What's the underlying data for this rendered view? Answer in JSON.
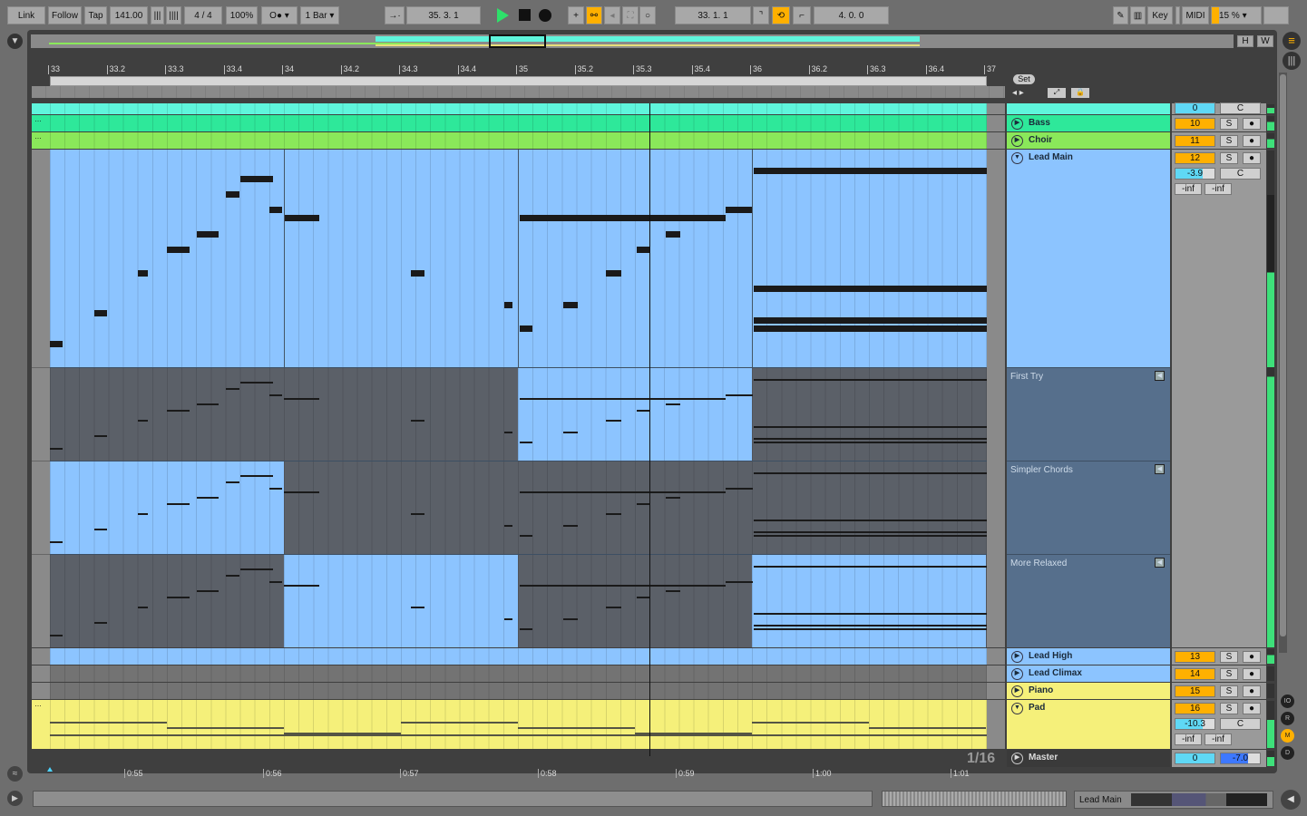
{
  "toolbar": {
    "link": "Link",
    "follow": "Follow",
    "tap": "Tap",
    "tempo": "141.00",
    "signature": "4 / 4",
    "zoom": "100%",
    "rec_mode": "O●",
    "quantize": "1 Bar",
    "position": "35.  3.  1",
    "loop_start": "33.  1.  1",
    "loop_length": "4.  0.  0",
    "key": "Key",
    "midi": "MIDI",
    "cpu": "15 %",
    "cpu_level": 15
  },
  "overview": {
    "h": "H",
    "w": "W"
  },
  "ruler": {
    "bars": [
      "33",
      "33.2",
      "33.3",
      "33.4",
      "34",
      "34.2",
      "34.3",
      "34.4",
      "35",
      "35.2",
      "35.3",
      "35.4",
      "36",
      "36.2",
      "36.3",
      "36.4",
      "37"
    ]
  },
  "set_button": "Set",
  "time_ruler": [
    "0:55",
    "0:56",
    "0:57",
    "0:58",
    "0:59",
    "1:00",
    "1:01"
  ],
  "grid": "1/16",
  "colors": {
    "cyan": "#5ff5dc",
    "bass": "#2ee89a",
    "choir": "#8ae85a",
    "blue": "#8cc4ff",
    "yellow": "#f5f07a",
    "take": "#566f8c",
    "accent": "#ffb000"
  },
  "tracks": [
    {
      "name": "",
      "num": "0",
      "vol": "C",
      "color": "#5ff5dc"
    },
    {
      "name": "Bass",
      "num": "10",
      "s": "S",
      "color": "#2ee89a"
    },
    {
      "name": "Choir",
      "num": "11",
      "s": "S",
      "color": "#8ae85a"
    },
    {
      "name": "Lead Main",
      "num": "12",
      "s": "S",
      "vol": "-3.9",
      "pan": "C",
      "peak1": "-inf",
      "peak2": "-inf",
      "color": "#8cc4ff"
    },
    {
      "name": "Lead High",
      "num": "13",
      "s": "S",
      "color": "#8cc4ff"
    },
    {
      "name": "Lead Climax",
      "num": "14",
      "s": "S",
      "color": "#8cc4ff"
    },
    {
      "name": "Piano",
      "num": "15",
      "s": "S",
      "color": "#f5f07a"
    },
    {
      "name": "Pad",
      "num": "16",
      "s": "S",
      "vol": "-10.3",
      "pan": "C",
      "peak1": "-inf",
      "peak2": "-inf",
      "color": "#f5f07a"
    },
    {
      "name": "Master",
      "num": "0",
      "vol": "-7.0"
    }
  ],
  "takes": [
    {
      "name": "First Try"
    },
    {
      "name": "Simpler Chords"
    },
    {
      "name": "More Relaxed"
    }
  ],
  "notes": [
    [
      0,
      0.22,
      0
    ],
    [
      0.76,
      0.22,
      4
    ],
    [
      1.5,
      0.17,
      9
    ],
    [
      2.0,
      0.39,
      12
    ],
    [
      2.51,
      0.37,
      14
    ],
    [
      3.01,
      0.23,
      19
    ],
    [
      3.26,
      0.56,
      21
    ],
    [
      3.75,
      0.22,
      17
    ],
    [
      4.0,
      0.6,
      16
    ],
    [
      6.17,
      0.23,
      9
    ],
    [
      7.77,
      0.14,
      5
    ],
    [
      8.03,
      0.22,
      2
    ],
    [
      8.03,
      3.52,
      16
    ],
    [
      8.78,
      0.25,
      5
    ],
    [
      9.5,
      0.26,
      9
    ],
    [
      10.03,
      0.22,
      12
    ],
    [
      10.53,
      0.25,
      14
    ],
    [
      11.55,
      0.47,
      17
    ],
    [
      12.03,
      4.0,
      22
    ],
    [
      12.03,
      4.0,
      7
    ],
    [
      12.03,
      4.0,
      3
    ],
    [
      12.03,
      4.0,
      2
    ]
  ],
  "playhead_beat": 10.25,
  "bottom": {
    "selected_track": "Lead Main"
  }
}
